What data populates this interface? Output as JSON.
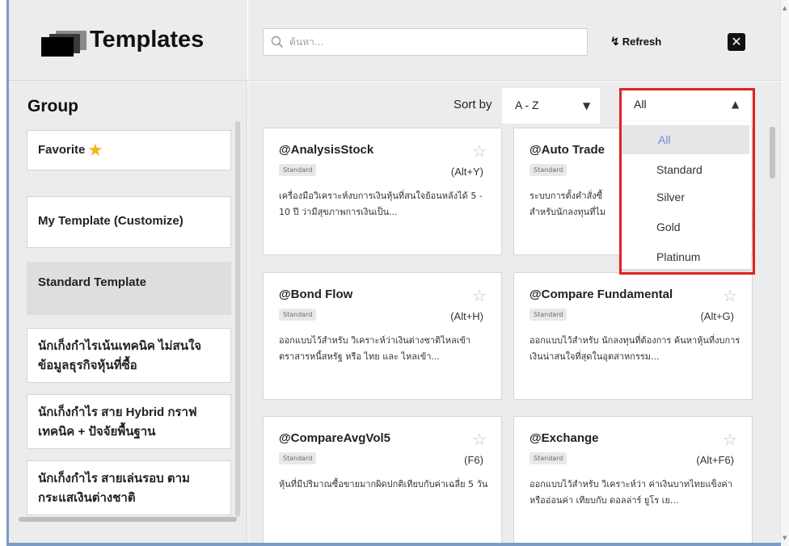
{
  "brand": {
    "title": "Templates"
  },
  "sidebar": {
    "heading": "Group",
    "items": [
      {
        "label": "Favorite",
        "icon": "star-icon"
      },
      {
        "label": "My Template (Customize)"
      },
      {
        "label": "Standard Template",
        "active": true
      },
      {
        "label": "นักเก็งกำไรเน้นเทคนิค ไม่สนใจข้อมูลธุรกิจหุ้นที่ซื้อ"
      },
      {
        "label": "นักเก็งกำไร สาย Hybrid กราฟเทคนิค + ปัจจัยพื้นฐาน"
      },
      {
        "label": "นักเก็งกำไร สายเล่นรอบ ตามกระแสเงินต่างชาติ"
      }
    ]
  },
  "toolbar": {
    "search_placeholder": "ค้นหา...",
    "refresh_label": "Refresh",
    "close_label": "✕"
  },
  "sort": {
    "label": "Sort by",
    "value": "A - Z"
  },
  "filter": {
    "value": "All",
    "options": [
      "All",
      "Standard",
      "Silver",
      "Gold",
      "Platinum"
    ],
    "selected_index": 0
  },
  "colors": {
    "selected_option": "#6a8fd9",
    "favorite_star": "#f5b71c",
    "highlight_border": "#e02222"
  },
  "cards": [
    {
      "title": "@AnalysisStock",
      "badge": "Standard",
      "shortcut": "(Alt+Y)",
      "desc": "เครื่องมือวิเคราะห์งบการเงินหุ้นที่สนใจย้อนหลังได้ 5 - 10 ปี ว่ามีสุขภาพการเงินเป็น..."
    },
    {
      "title": "@Auto Trade",
      "badge": "Standard",
      "shortcut": "",
      "desc": "ระบบการตั้งคำสั่งซื้"
    },
    {
      "title": "@Bond Flow",
      "badge": "Standard",
      "shortcut": "(Alt+H)",
      "desc": "ออกแบบไว้สำหรับ วิเคราะห์ว่าเงินต่างชาติไหลเข้า ตราสารหนี้สหรัฐ หรือ ไทย และ ไหลเข้า..."
    },
    {
      "title": "@Compare Fundamental",
      "badge": "Standard",
      "shortcut": "(Alt+G)",
      "desc": "ออกแบบไว้สำหรับ นักลงทุนที่ต้องการ ค้นหาหุ้นที่งบการเงินน่าสนใจที่สุดในอุตสาหกรรม..."
    },
    {
      "title": "@CompareAvgVol5",
      "badge": "Standard",
      "shortcut": "(F6)",
      "desc": "หุ้นที่มีปริมาณซื้อขายมากผิดปกติเทียบกับค่าเฉลี่ย 5 วัน"
    },
    {
      "title": "@Exchange",
      "badge": "Standard",
      "shortcut": "(Alt+F6)",
      "desc": "ออกแบบไว้สำหรับ วิเคราะห์ว่า ค่าเงินบาทไทยแข็งค่าหรืออ่อนค่า เทียบกับ ดอลล่าร์ ยูโร เย..."
    }
  ],
  "card_auto_trade_desc_line2": "สำหรับนักลงทุนที่ไม"
}
